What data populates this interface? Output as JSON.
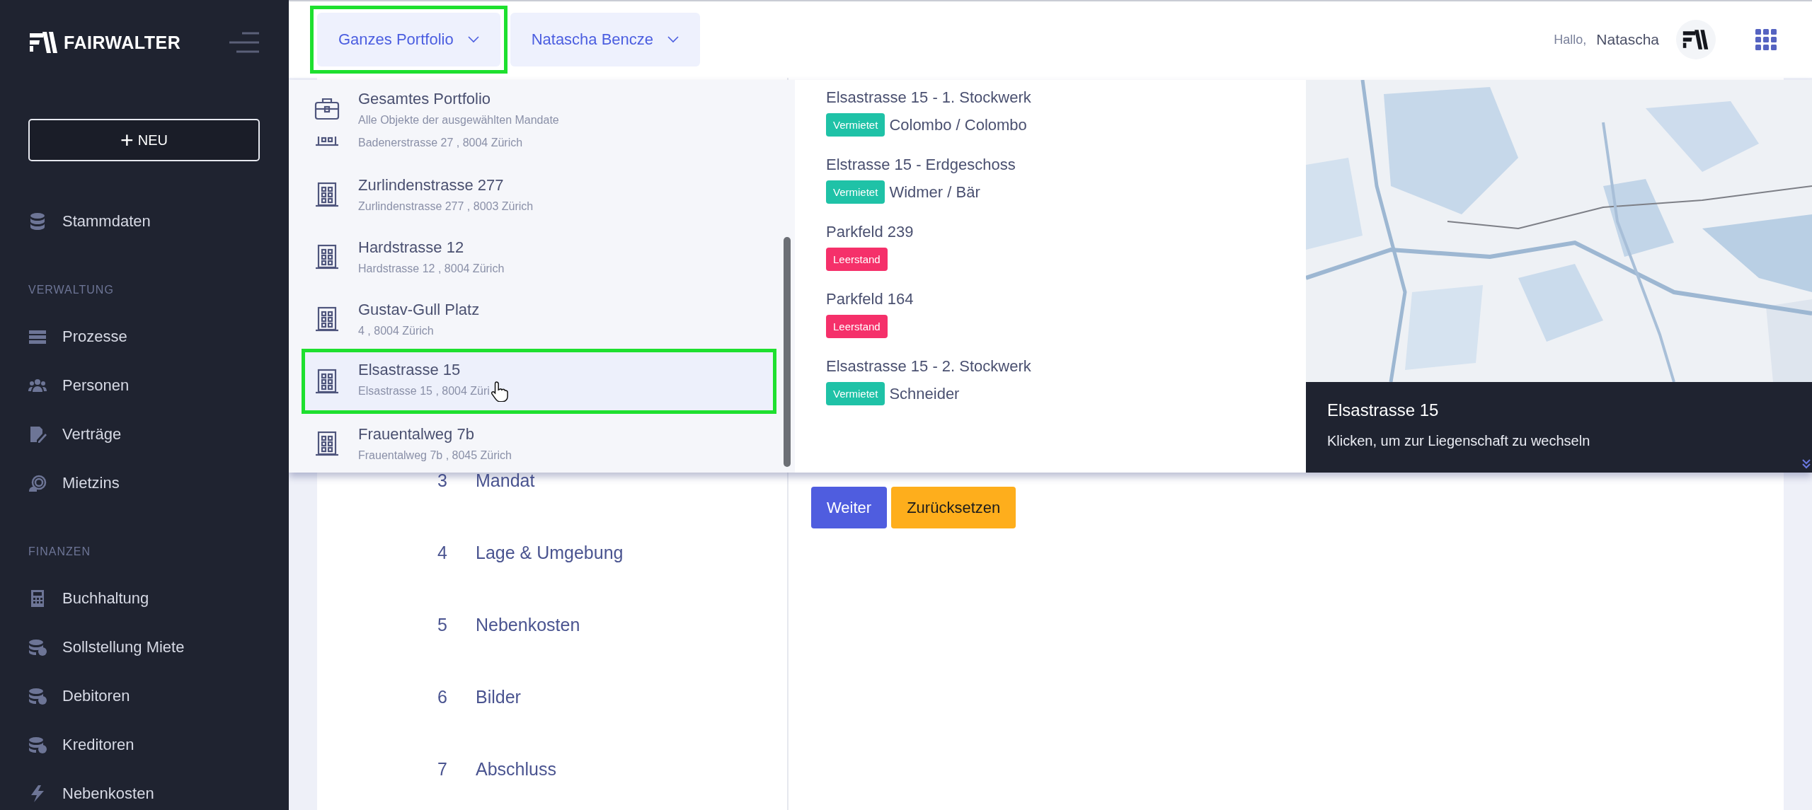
{
  "sidebar": {
    "logo": "FAIRWALTER",
    "new_button": {
      "icon": "+",
      "label": "NEU"
    },
    "sections": [
      {
        "items": [
          {
            "label": "Stammdaten"
          }
        ]
      },
      {
        "heading": "VERWALTUNG",
        "items": [
          {
            "label": "Prozesse"
          },
          {
            "label": "Personen"
          },
          {
            "label": "Verträge"
          },
          {
            "label": "Mietzins"
          }
        ]
      },
      {
        "heading": "FINANZEN",
        "items": [
          {
            "label": "Buchhaltung"
          },
          {
            "label": "Sollstellung Miete"
          },
          {
            "label": "Debitoren"
          },
          {
            "label": "Kreditoren"
          },
          {
            "label": "Nebenkosten"
          }
        ]
      }
    ]
  },
  "topbar": {
    "selectors": [
      {
        "label": "Ganzes Portfolio",
        "highlighted": true
      },
      {
        "label": "Natascha Bencze",
        "highlighted": false
      }
    ],
    "greeting": "Hallo,",
    "user": "Natascha"
  },
  "portfolio_dropdown": {
    "properties": [
      {
        "kind": "portfolio",
        "name": "Gesamtes Portfolio",
        "address": "Alle Objekte der ausgewählten Mandate",
        "hovered": false,
        "highlighted": false
      },
      {
        "kind": "partial",
        "address": "Badenerstrasse 27 , 8004 Zürich",
        "hovered": false,
        "highlighted": false
      },
      {
        "kind": "building",
        "name": "Zurlindenstrasse 277",
        "address": "Zurlindenstrasse 277 , 8003 Zürich",
        "hovered": false,
        "highlighted": false
      },
      {
        "kind": "building",
        "name": "Hardstrasse 12",
        "address": "Hardstrasse 12 , 8004 Zürich",
        "hovered": false,
        "highlighted": false
      },
      {
        "kind": "building",
        "name": "Gustav-Gull Platz",
        "address": "4 , 8004 Zürich",
        "hovered": false,
        "highlighted": false
      },
      {
        "kind": "building",
        "name": "Elsastrasse 15",
        "address": "Elsastrasse 15 , 8004 Züri",
        "hovered": true,
        "highlighted": true
      },
      {
        "kind": "building",
        "name": "Frauentalweg 7b",
        "address": "Frauentalweg 7b , 8045 Zürich",
        "hovered": false,
        "highlighted": false
      }
    ],
    "units": [
      {
        "name": "Elsastrasse 15 - 1. Stockwerk",
        "status": "Vermietet",
        "color": "#1fc2a7",
        "tenant": "Colombo / Colombo"
      },
      {
        "name": "Elstrasse 15 - Erdgeschoss",
        "status": "Vermietet",
        "color": "#1fc2a7",
        "tenant": "Widmer / Bär"
      },
      {
        "name": "Parkfeld 239",
        "status": "Leerstand",
        "color": "#f5306a"
      },
      {
        "name": "Parkfeld 164",
        "status": "Leerstand",
        "color": "#f5306a"
      },
      {
        "name": "Elsastrasse 15 - 2. Stockwerk",
        "status": "Vermietet",
        "color": "#1fc2a7",
        "tenant": "Schneider"
      }
    ],
    "map_caption": {
      "title": "Elsastrasse 15",
      "hint": "Klicken, um zur Liegenschaft zu wechseln"
    }
  },
  "steps": [
    {
      "number": "3",
      "label": "Mandat"
    },
    {
      "number": "4",
      "label": "Lage & Umgebung"
    },
    {
      "number": "5",
      "label": "Nebenkosten"
    },
    {
      "number": "6",
      "label": "Bilder"
    },
    {
      "number": "7",
      "label": "Abschluss"
    }
  ],
  "buttons": [
    {
      "label": "Weiter",
      "kind": "primary"
    },
    {
      "label": "Zurücksetzen",
      "kind": "warning"
    }
  ]
}
